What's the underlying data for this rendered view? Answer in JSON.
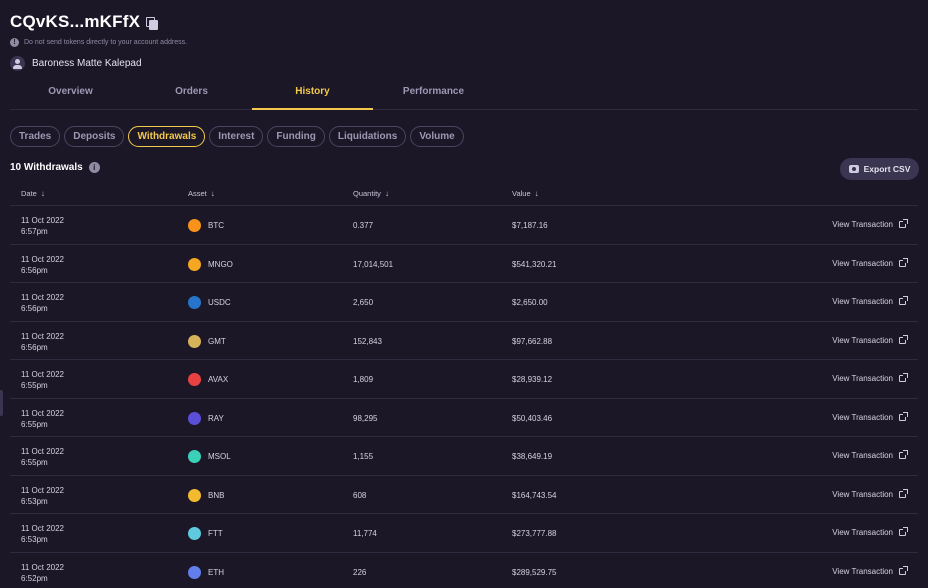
{
  "header": {
    "address": "CQvKS...mKFfX",
    "warning": "Do not send tokens directly to your account address.",
    "owner": "Baroness Matte Kalepad"
  },
  "tabs": [
    "Overview",
    "Orders",
    "History",
    "Performance"
  ],
  "active_tab": "History",
  "chips": [
    "Trades",
    "Deposits",
    "Withdrawals",
    "Interest",
    "Funding",
    "Liquidations",
    "Volume"
  ],
  "active_chip": "Withdrawals",
  "count_label": "10 Withdrawals",
  "export_label": "Export CSV",
  "columns": [
    "Date",
    "Asset",
    "Quantity",
    "Value"
  ],
  "view_label": "View Transaction",
  "colors": {
    "accent": "#f2c94c",
    "background": "#1b1727",
    "button": "#3a3550"
  },
  "rows": [
    {
      "date": "11 Oct 2022",
      "time": "6:57pm",
      "asset": "BTC",
      "qty": "0.377",
      "value": "$7,187.16",
      "icon": "btc-icon",
      "color": "#f7931a"
    },
    {
      "date": "11 Oct 2022",
      "time": "6:56pm",
      "asset": "MNGO",
      "qty": "17,014,501",
      "value": "$541,320.21",
      "icon": "mngo-icon",
      "color": "#f5a623"
    },
    {
      "date": "11 Oct 2022",
      "time": "6:56pm",
      "asset": "USDC",
      "qty": "2,650",
      "value": "$2,650.00",
      "icon": "usdc-icon",
      "color": "#2775ca"
    },
    {
      "date": "11 Oct 2022",
      "time": "6:56pm",
      "asset": "GMT",
      "qty": "152,843",
      "value": "$97,662.88",
      "icon": "gmt-icon",
      "color": "#d6b25a"
    },
    {
      "date": "11 Oct 2022",
      "time": "6:55pm",
      "asset": "AVAX",
      "qty": "1,809",
      "value": "$28,939.12",
      "icon": "avax-icon",
      "color": "#e84142"
    },
    {
      "date": "11 Oct 2022",
      "time": "6:55pm",
      "asset": "RAY",
      "qty": "98,295",
      "value": "$50,403.46",
      "icon": "ray-icon",
      "color": "#5a4fd6"
    },
    {
      "date": "11 Oct 2022",
      "time": "6:55pm",
      "asset": "MSOL",
      "qty": "1,155",
      "value": "$38,649.19",
      "icon": "msol-icon",
      "color": "#3bd1b8"
    },
    {
      "date": "11 Oct 2022",
      "time": "6:53pm",
      "asset": "BNB",
      "qty": "608",
      "value": "$164,743.54",
      "icon": "bnb-icon",
      "color": "#f3ba2f"
    },
    {
      "date": "11 Oct 2022",
      "time": "6:53pm",
      "asset": "FTT",
      "qty": "11,774",
      "value": "$273,777.88",
      "icon": "ftt-icon",
      "color": "#5fcade"
    },
    {
      "date": "11 Oct 2022",
      "time": "6:52pm",
      "asset": "ETH",
      "qty": "226",
      "value": "$289,529.75",
      "icon": "eth-icon",
      "color": "#627eea"
    }
  ]
}
